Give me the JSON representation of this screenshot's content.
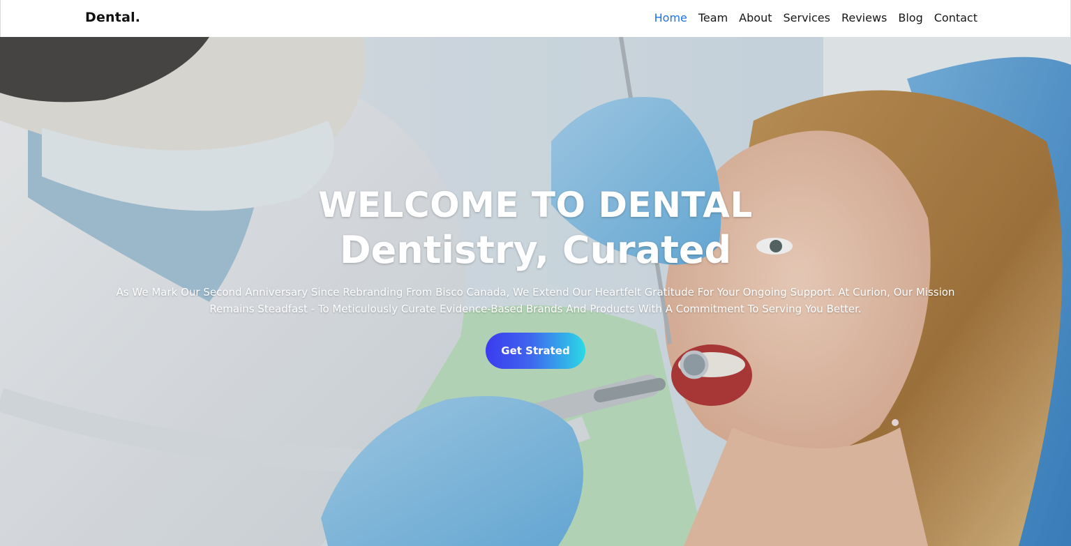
{
  "header": {
    "brand": "Dental.",
    "nav": [
      {
        "label": "Home",
        "active": true
      },
      {
        "label": "Team",
        "active": false
      },
      {
        "label": "About",
        "active": false
      },
      {
        "label": "Services",
        "active": false
      },
      {
        "label": "Reviews",
        "active": false
      },
      {
        "label": "Blog",
        "active": false
      },
      {
        "label": "Contact",
        "active": false
      }
    ],
    "active_color": "#1a73e8"
  },
  "hero": {
    "title": "WELCOME TO DENTAL",
    "subtitle": "Dentistry, Curated",
    "description": "As We Mark Our Second Anniversary Since Rebranding From Bisco Canada, We Extend Our Heartfelt Gratitude For Your Ongoing Support. At Curion, Our Mission Remains Steadfast - To Meticulously Curate Evidence-Based Brands And Products With A Commitment To Serving You Better.",
    "cta_label": "Get Strated",
    "cta_gradient": [
      "#3b3bf0",
      "#2bd9e6"
    ],
    "image": "dentist-treating-patient-photo"
  }
}
